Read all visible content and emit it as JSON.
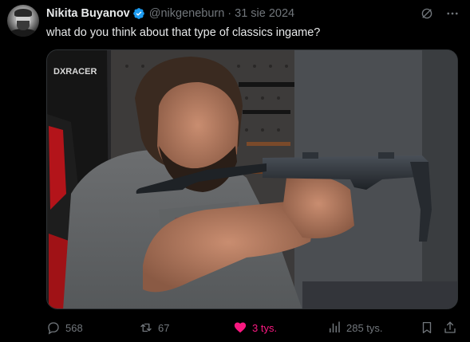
{
  "author": {
    "display_name": "Nikita Buyanov",
    "handle": "@nikgeneburn",
    "separator": "·",
    "date": "31 sie 2024",
    "verified": true
  },
  "tweet": {
    "text": "what do you think about that type of classics ingame?"
  },
  "media": {
    "chair_brand": "DXRACER"
  },
  "actions": {
    "replies": "568",
    "reposts": "67",
    "likes": "3 tys.",
    "views": "285 tys."
  },
  "colors": {
    "background": "#000000",
    "text": "#e7e9ea",
    "muted": "#71767b",
    "verified": "#1d9bf0",
    "like": "#f91880"
  },
  "icons": [
    "verified-icon",
    "grok-icon",
    "more-icon",
    "reply-icon",
    "repost-icon",
    "like-icon",
    "views-icon",
    "bookmark-icon",
    "share-icon"
  ]
}
